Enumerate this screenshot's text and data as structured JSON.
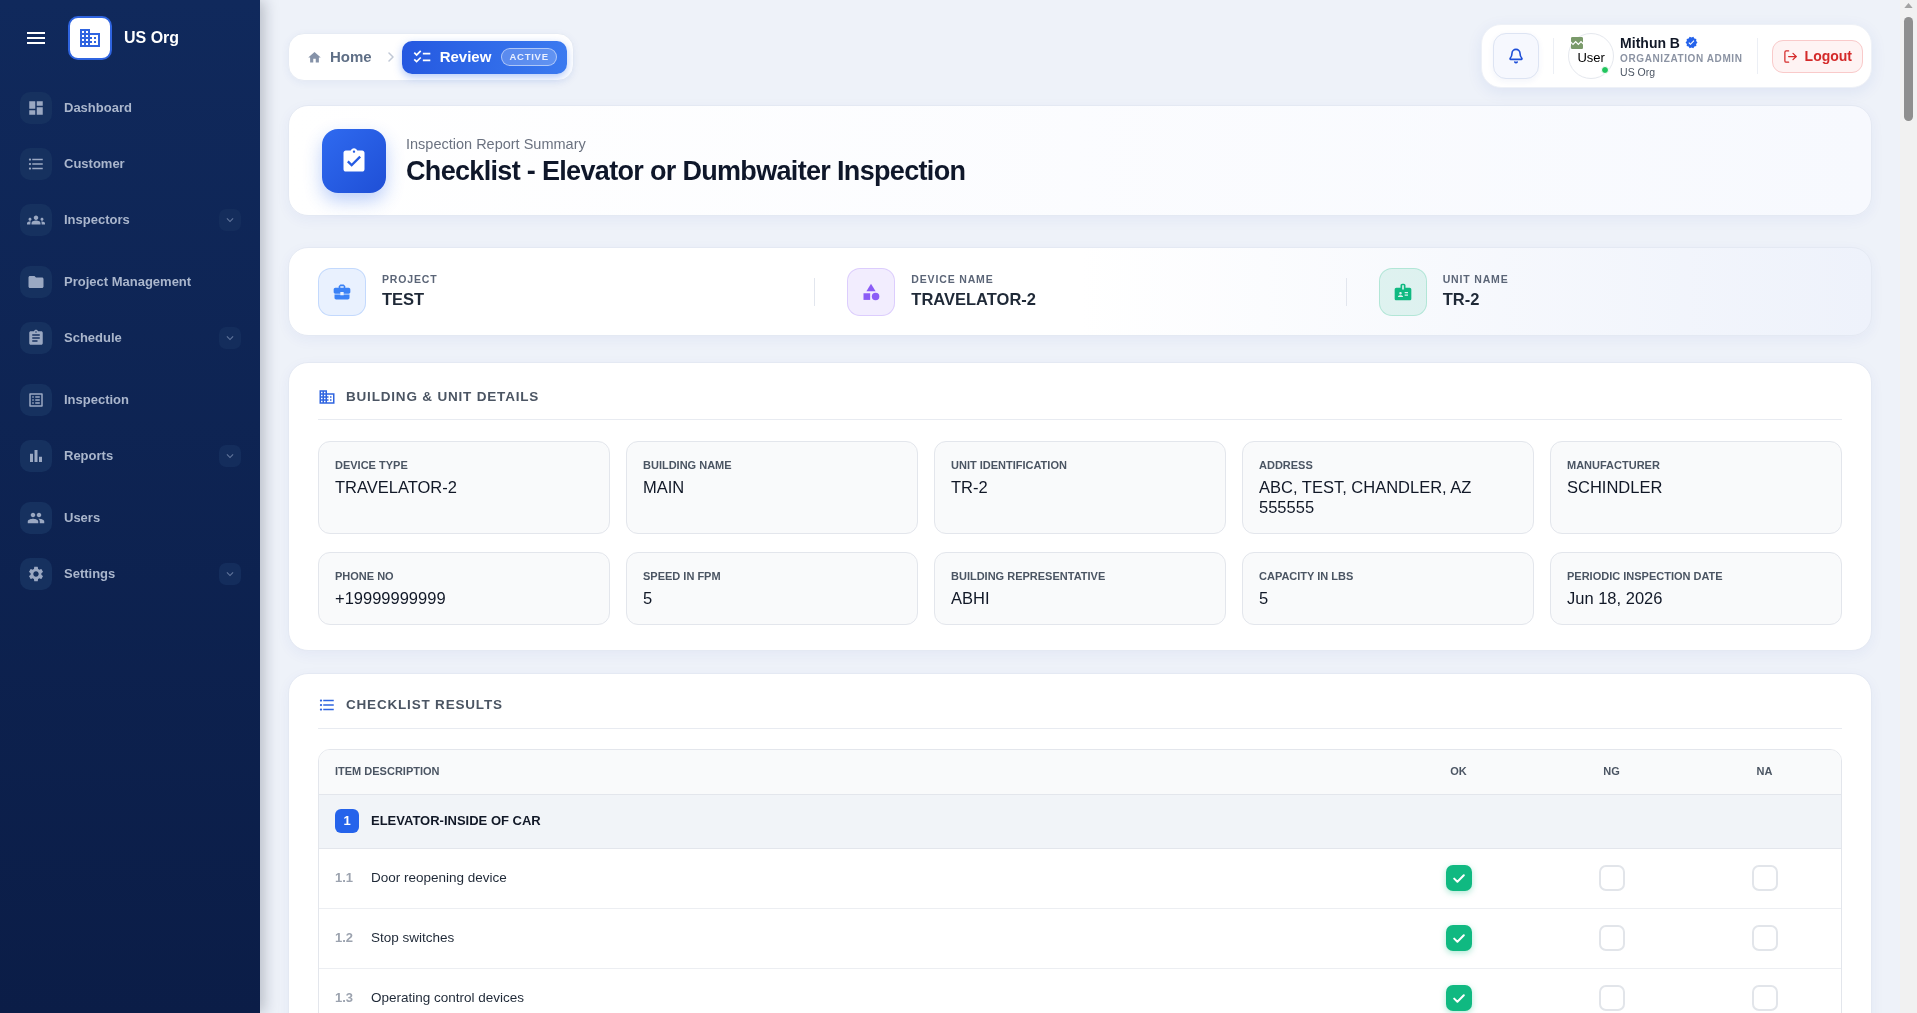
{
  "sidebar": {
    "org_name": "US Org",
    "items": [
      {
        "label": "Dashboard",
        "selected": false,
        "expandable": false
      },
      {
        "label": "Customer",
        "selected": false,
        "expandable": false
      },
      {
        "label": "Inspectors",
        "selected": false,
        "expandable": true
      },
      {
        "label": "Project Management",
        "selected": false,
        "expandable": false
      },
      {
        "label": "Schedule",
        "selected": false,
        "expandable": true
      },
      {
        "label": "Inspection",
        "selected": false,
        "expandable": false
      },
      {
        "label": "Reports",
        "selected": false,
        "expandable": true
      },
      {
        "label": "Users",
        "selected": false,
        "expandable": false
      },
      {
        "label": "Settings",
        "selected": false,
        "expandable": true
      }
    ]
  },
  "breadcrumb": [
    {
      "label": "Home",
      "selected": false
    },
    {
      "label": "Review",
      "selected": true,
      "badge": "ACTIVE"
    }
  ],
  "user": {
    "avatar_label": "User",
    "online": true,
    "name": "Mithun B",
    "verified": true,
    "role": "ORGANIZATION ADMIN",
    "org": "US Org",
    "logout": "Logout"
  },
  "header": {
    "subtitle": "Inspection Report Summary",
    "title": "Checklist - Elevator or Dumbwaiter Inspection"
  },
  "summary": [
    {
      "label": "PROJECT",
      "value": "TEST",
      "color": "#3b82f6"
    },
    {
      "label": "DEVICE NAME",
      "value": "TRAVELATOR-2",
      "color": "#8b5cf6"
    },
    {
      "label": "UNIT NAME",
      "value": "TR-2",
      "color": "#10b981"
    }
  ],
  "building_details": {
    "title": "BUILDING & UNIT DETAILS",
    "fields": [
      {
        "label": "DEVICE TYPE",
        "value": "TRAVELATOR-2"
      },
      {
        "label": "BUILDING NAME",
        "value": "MAIN"
      },
      {
        "label": "UNIT IDENTIFICATION",
        "value": "TR-2"
      },
      {
        "label": "ADDRESS",
        "value": "ABC, TEST, CHANDLER, AZ 555555"
      },
      {
        "label": "MANUFACTURER",
        "value": "SCHINDLER"
      },
      {
        "label": "PHONE NO",
        "value": "+19999999999"
      },
      {
        "label": "SPEED IN FPM",
        "value": "5"
      },
      {
        "label": "BUILDING REPRESENTATIVE",
        "value": "ABHI"
      },
      {
        "label": "CAPACITY IN LBS",
        "value": "5"
      },
      {
        "label": "PERIODIC INSPECTION DATE",
        "value": "Jun 18, 2026"
      }
    ]
  },
  "checklist": {
    "title": "CHECKLIST RESULTS",
    "columns": [
      "ITEM DESCRIPTION",
      "OK",
      "NG",
      "NA"
    ],
    "sections": [
      {
        "number": "1",
        "title": "ELEVATOR-INSIDE OF CAR",
        "items": [
          {
            "number": "1.1",
            "description": "Door reopening device",
            "ok": true,
            "ng": false,
            "na": false
          },
          {
            "number": "1.2",
            "description": "Stop switches",
            "ok": true,
            "ng": false,
            "na": false
          },
          {
            "number": "1.3",
            "description": "Operating control devices",
            "ok": true,
            "ng": false,
            "na": false
          }
        ]
      }
    ]
  }
}
